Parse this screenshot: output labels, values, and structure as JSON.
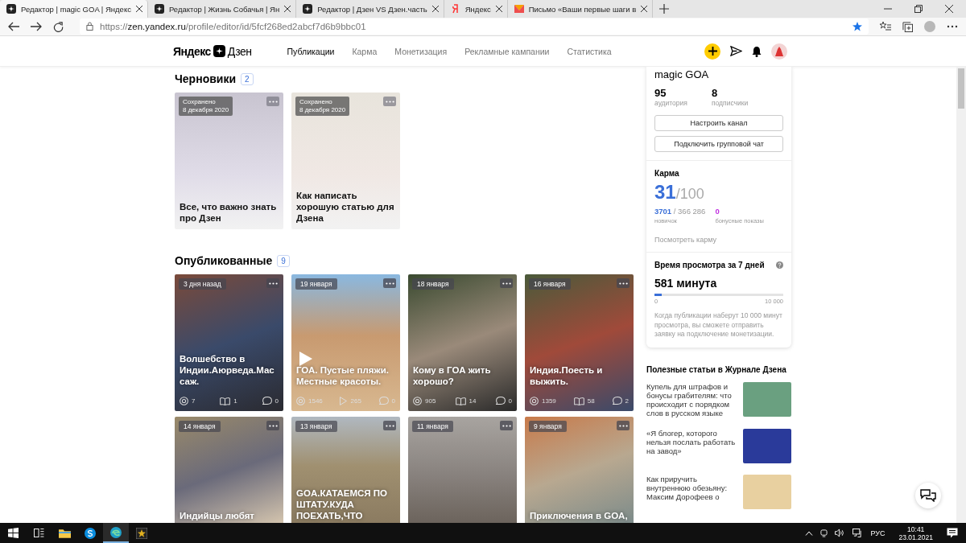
{
  "browser": {
    "tabs": [
      {
        "title": "Редактор | magic GOA | Яндекс",
        "kind": "zen",
        "selected": true
      },
      {
        "title": "Редактор | Жизнь Собачья | Ян",
        "kind": "zen",
        "selected": false
      },
      {
        "title": "Редактор | Дзен VS Дзен.часть",
        "kind": "zen",
        "selected": false
      },
      {
        "title": "Яндекс",
        "kind": "yandex",
        "selected": false
      },
      {
        "title": "Письмо «Ваши первые шаги в",
        "kind": "mail",
        "selected": false
      }
    ],
    "url": {
      "scheme": "https://",
      "domain": "zen.yandex.ru",
      "path": "/profile/editor/id/5fcf268ed2abcf7d6b9bbc01"
    }
  },
  "header": {
    "logo_left": "Яндекс",
    "logo_right": "Дзен",
    "nav": [
      {
        "label": "Публикации",
        "selected": true
      },
      {
        "label": "Карма",
        "selected": false
      },
      {
        "label": "Монетизация",
        "selected": false
      },
      {
        "label": "Рекламные кампании",
        "selected": false
      },
      {
        "label": "Статистика",
        "selected": false
      }
    ]
  },
  "drafts": {
    "title": "Черновики",
    "count": "2",
    "cards": [
      {
        "status": "Сохранено",
        "date": "8 декабря 2020",
        "title": "Все, что важно знать про Дзен"
      },
      {
        "status": "Сохранено",
        "date": "8 декабря 2020",
        "title": "Как написать хорошую статью для Дзена"
      }
    ]
  },
  "published": {
    "title": "Опубликованные",
    "count": "9",
    "cards": [
      {
        "date": "3 дня назад",
        "title": "Волшебство в Индии.Аюрведа.Массаж.",
        "video": false,
        "stats": [
          {
            "kind": "views",
            "value": "7"
          },
          {
            "kind": "reads",
            "value": "1"
          },
          {
            "kind": "comments",
            "value": "0"
          }
        ]
      },
      {
        "date": "19 января",
        "title": "ГОА. Пустые пляжи. Местные красоты.",
        "video": true,
        "stats": [
          {
            "kind": "views",
            "value": "1546"
          },
          {
            "kind": "plays",
            "value": "265"
          },
          {
            "kind": "comments",
            "value": "0"
          }
        ]
      },
      {
        "date": "18 января",
        "title": "Кому в ГОА жить хорошо?",
        "video": false,
        "stats": [
          {
            "kind": "views",
            "value": "905"
          },
          {
            "kind": "reads",
            "value": "14"
          },
          {
            "kind": "comments",
            "value": "0"
          }
        ]
      },
      {
        "date": "16 января",
        "title": "Индия.Поесть и выжить.",
        "video": false,
        "stats": [
          {
            "kind": "views",
            "value": "1359"
          },
          {
            "kind": "reads",
            "value": "58"
          },
          {
            "kind": "comments",
            "value": "2"
          }
        ]
      },
      {
        "date": "14 января",
        "title": "Индийцы любят",
        "video": false
      },
      {
        "date": "13 января",
        "title": "GOA.КАТАЕМСЯ ПО ШТАТУ.КУДА ПОЕХАТЬ,ЧТО",
        "video": false
      },
      {
        "date": "11 января",
        "video": false
      },
      {
        "date": "9 января",
        "title": "Приключения в GOA,",
        "video": false
      }
    ]
  },
  "channel": {
    "name": "magic GOA",
    "stats": [
      {
        "value": "95",
        "label": "аудитория"
      },
      {
        "value": "8",
        "label": "подписчики"
      }
    ],
    "buttons": [
      "Настроить канал",
      "Подключить групповой чат"
    ]
  },
  "karma": {
    "title": "Карма",
    "score": "31",
    "max": "/100",
    "progress": "3701",
    "total": " / 366 286",
    "progress_label": "новичок",
    "bonus": "0",
    "bonus_label": "бонусные показы",
    "link": "Посмотреть карму"
  },
  "watch_time": {
    "title": "Время просмотра за 7 дней",
    "value": "581 минута",
    "level": 0.058,
    "min": "0",
    "max": "10 000",
    "note": "Когда публикации наберут 10 000 минут просмотра, вы сможете отправить заявку на подключение монетизации."
  },
  "articles": {
    "title": "Полезные статьи в Журнале Дзена",
    "items": [
      {
        "text": "Купель для штрафов и бонусы грабителям: что происходит с порядком слов в русском языке"
      },
      {
        "text": "«Я блогер, которого нельзя послать работать на завод»"
      },
      {
        "text": "Как приручить внутреннюю обезьяну: Максим Дорофеев о"
      }
    ]
  },
  "taskbar": {
    "language": "РУС",
    "time": "10:41",
    "date": "23.01.2021"
  }
}
